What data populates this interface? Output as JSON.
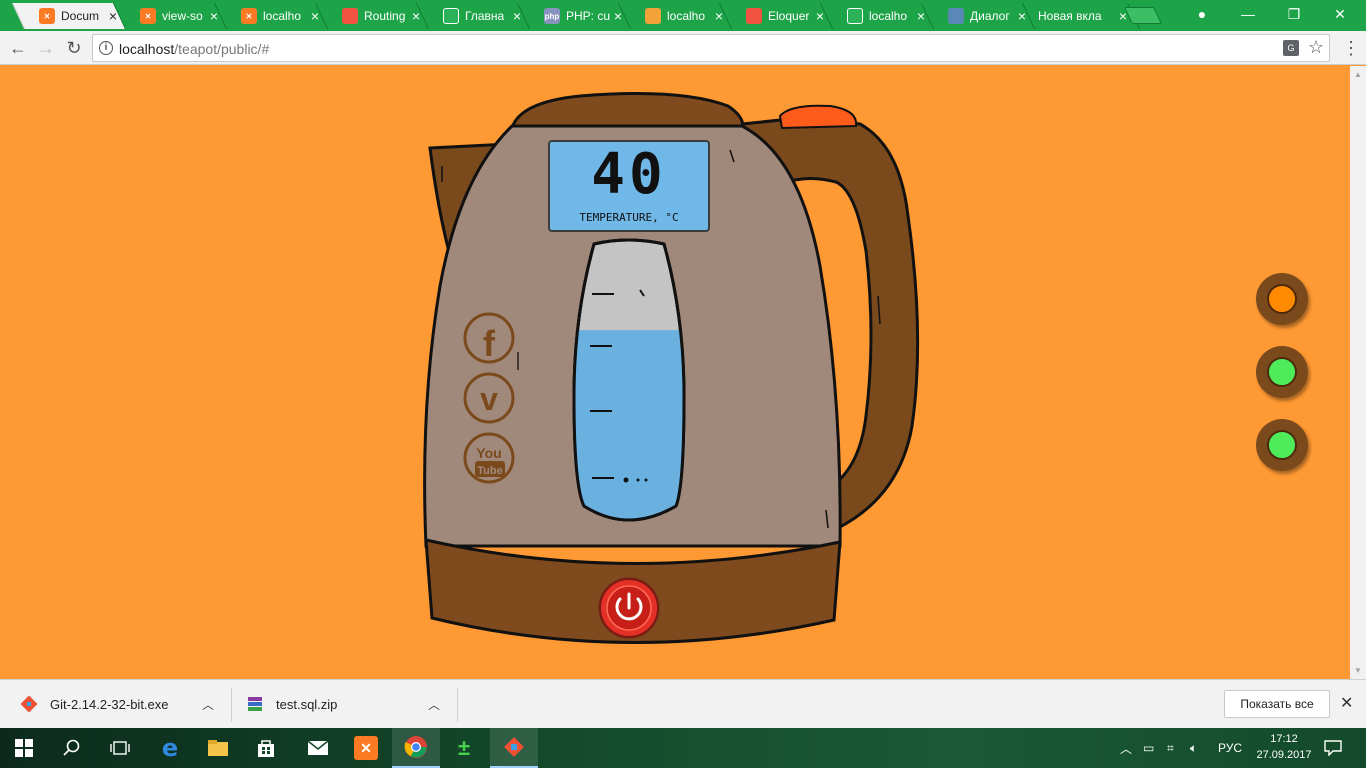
{
  "browser": {
    "tabs": [
      {
        "title": "Docum",
        "icon": "xampp-icon",
        "active": true
      },
      {
        "title": "view-so",
        "icon": "xampp-icon"
      },
      {
        "title": "localho",
        "icon": "xampp-icon"
      },
      {
        "title": "Routing",
        "icon": "laravel-icon"
      },
      {
        "title": "Главна",
        "icon": "page-icon"
      },
      {
        "title": "PHP: cu",
        "icon": "php-icon"
      },
      {
        "title": "localho",
        "icon": "phpmyadmin-icon"
      },
      {
        "title": "Eloquer",
        "icon": "laravel-icon"
      },
      {
        "title": "localho",
        "icon": "page-icon"
      },
      {
        "title": "Диалог",
        "icon": "chat-icon"
      },
      {
        "title": "Новая вкла",
        "icon": "none"
      }
    ],
    "url_host": "localhost",
    "url_path": "/teapot/public/#"
  },
  "kettle": {
    "temperature": "40",
    "temperature_label": "TEMPERATURE, °C",
    "water_level_fraction": 0.68,
    "social": [
      "facebook",
      "vimeo",
      "youtube"
    ],
    "social_youtube_top": "You",
    "social_youtube_bottom": "Tube",
    "colors": {
      "body": "#a0897a",
      "base": "#7f4a1e",
      "handle": "#7a4a1c",
      "lid_knob": "#ff5b1a",
      "water": "#6ab1e0",
      "lcd": "#6fb8e8",
      "power": "#e53027"
    }
  },
  "side_buttons": [
    {
      "name": "orange",
      "color": "#ff8a00"
    },
    {
      "name": "green-1",
      "color": "#4eec5a"
    },
    {
      "name": "green-2",
      "color": "#4eec5a"
    }
  ],
  "downloads": {
    "items": [
      {
        "name": "Git-2.14.2-32-bit.exe"
      },
      {
        "name": "test.sql.zip"
      }
    ],
    "show_all": "Показать все"
  },
  "taskbar": {
    "language": "РУС",
    "time": "17:12",
    "date": "27.09.2017"
  }
}
